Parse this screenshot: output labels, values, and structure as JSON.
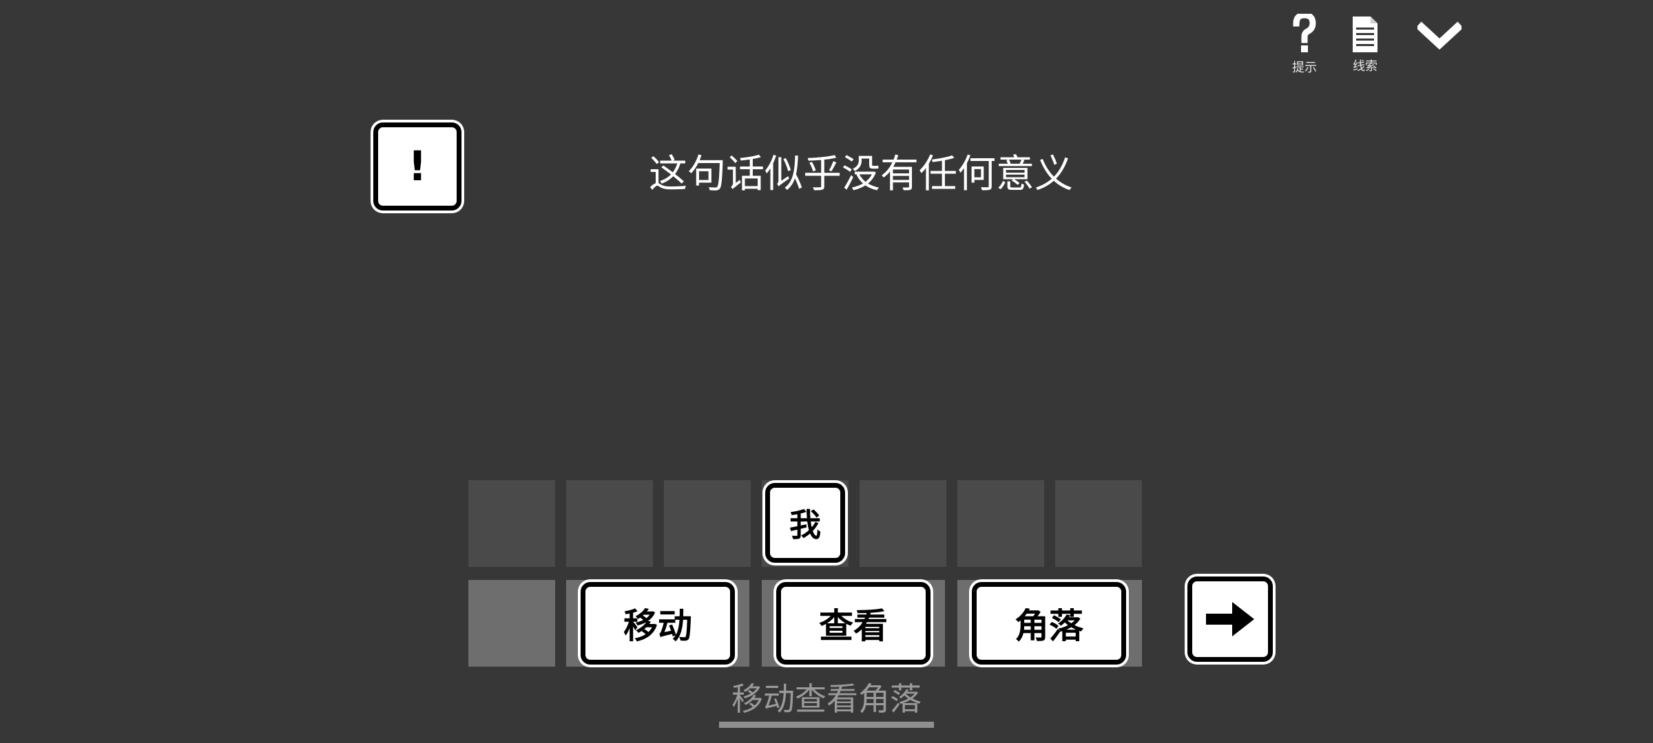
{
  "toolbar": {
    "hint": {
      "label": "提示",
      "icon": "question-icon"
    },
    "clues": {
      "label": "线索",
      "icon": "document-icon"
    },
    "collapse": {
      "icon": "chevron-down-icon"
    }
  },
  "alert": {
    "icon": "exclamation-icon",
    "symbol": "!"
  },
  "message": "这句话似乎没有任何意义",
  "top_row": {
    "slots": 7,
    "placed_word": {
      "slot": 4,
      "text": "我"
    }
  },
  "bottom_row": {
    "words": [
      "移动",
      "查看",
      "角落"
    ]
  },
  "submit": {
    "icon": "arrow-right-icon"
  },
  "preview_text": "移动查看角落",
  "colors": {
    "background": "#373737",
    "slot": "#4a4a4a",
    "slot_active": "#6e6e6e",
    "tile": "#ffffff",
    "tile_border": "#000000"
  }
}
